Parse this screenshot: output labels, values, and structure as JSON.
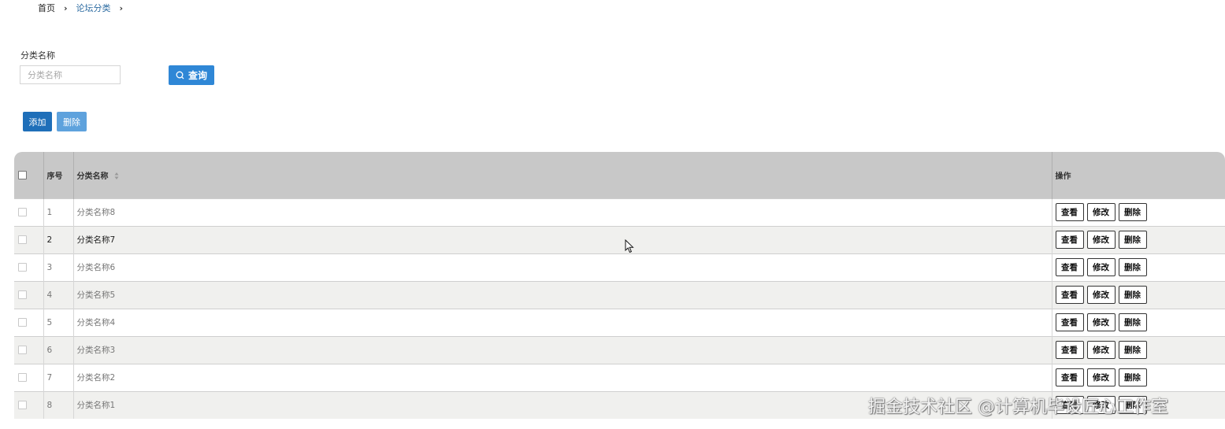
{
  "breadcrumb": {
    "home": "首页",
    "current": "论坛分类"
  },
  "filter": {
    "label": "分类名称",
    "placeholder": "分类名称",
    "query_label": "查询"
  },
  "actions": {
    "add_label": "添加",
    "delete_label": "删除"
  },
  "table": {
    "columns": {
      "seq": "序号",
      "name": "分类名称",
      "ops": "操作"
    },
    "row_buttons": {
      "view": "查看",
      "edit": "修改",
      "delete": "删除"
    },
    "rows": [
      {
        "seq": "1",
        "name": "分类名称8"
      },
      {
        "seq": "2",
        "name": "分类名称7"
      },
      {
        "seq": "3",
        "name": "分类名称6"
      },
      {
        "seq": "4",
        "name": "分类名称5"
      },
      {
        "seq": "5",
        "name": "分类名称4"
      },
      {
        "seq": "6",
        "name": "分类名称3"
      },
      {
        "seq": "7",
        "name": "分类名称2"
      },
      {
        "seq": "8",
        "name": "分类名称1"
      }
    ]
  },
  "watermark": "掘金技术社区 @计算机毕设匠心工作室",
  "colors": {
    "primary": "#2f87d6",
    "add_button": "#1f6fb9",
    "delete_button": "#5ea2dd",
    "header_bg": "#c8c8c8",
    "link": "#2d6ca2"
  }
}
